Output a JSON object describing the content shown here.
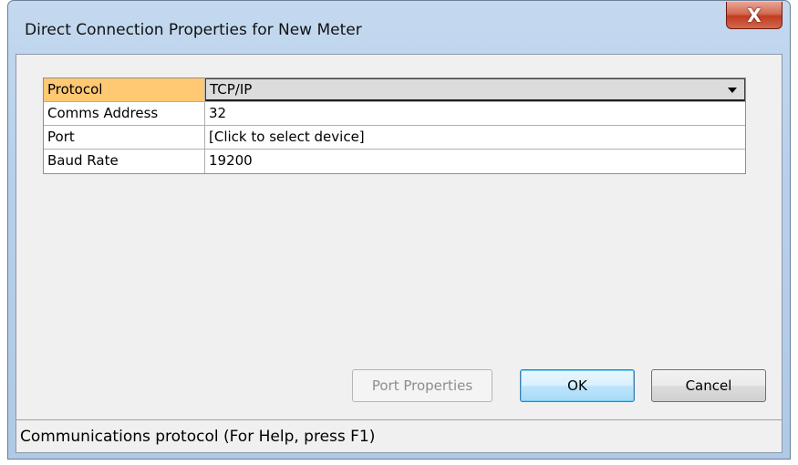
{
  "window": {
    "title": "Direct Connection Properties for New Meter",
    "close_glyph": "X"
  },
  "properties": [
    {
      "label": "Protocol",
      "value": "TCP/IP",
      "selected": true,
      "combo": true
    },
    {
      "label": "Comms Address",
      "value": "32",
      "selected": false,
      "combo": false
    },
    {
      "label": "Port",
      "value": "[Click to select device]",
      "selected": false,
      "combo": false
    },
    {
      "label": "Baud Rate",
      "value": "19200",
      "selected": false,
      "combo": false
    }
  ],
  "buttons": {
    "port_properties": "Port Properties",
    "ok": "OK",
    "cancel": "Cancel"
  },
  "status": {
    "text": "Communications protocol (For Help, press F1)"
  },
  "colors": {
    "selected_label_bg": "#ffc873",
    "title_bar": "#b9d1ea",
    "close_button": "#c7462b"
  },
  "icons": {
    "close": "close-icon",
    "dropdown": "chevron-down-icon"
  }
}
